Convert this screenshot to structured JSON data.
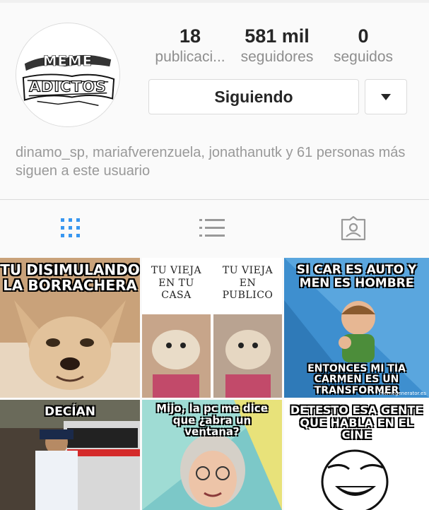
{
  "profile": {
    "avatar_text": "MEME ADICTOS",
    "stats": {
      "posts_count": "18",
      "posts_label": "publicaci...",
      "followers_count": "581 mil",
      "followers_label": "seguidores",
      "following_count": "0",
      "following_label": "seguidos"
    },
    "follow_button_label": "Siguiendo",
    "followed_by_text": "dinamo_sp, mariafverenzuela, jonathanutk y 61 personas más siguen a este usuario"
  },
  "tabs": [
    {
      "name": "grid",
      "active": true,
      "icon": "grid-icon"
    },
    {
      "name": "list",
      "active": false,
      "icon": "list-icon"
    },
    {
      "name": "tagged",
      "active": false,
      "icon": "tagged-person-icon"
    }
  ],
  "colors": {
    "active_tab": "#3897f0",
    "inactive_icon": "#999999",
    "border": "#dbdbdb"
  },
  "posts": [
    {
      "caption": "TU DISIMULANDO LA BORRACHERA"
    },
    {
      "left_caption": "TU VIEJA EN TU CASA",
      "right_caption": "TU VIEJA EN PUBLICO"
    },
    {
      "top_caption": "SI CAR ES AUTO Y MEN ES HOMBRE",
      "bottom_caption": "ENTONCES MI TIA CARMEN ES UN TRANSFORMER",
      "watermark": "memegenerator.es"
    },
    {
      "caption": "DECÍAN"
    },
    {
      "caption": "Mijo, la pc me dice que ¿abra un ventana?"
    },
    {
      "caption": "DETESTO ESA GENTE QUE HABLA EN EL CINE"
    }
  ]
}
